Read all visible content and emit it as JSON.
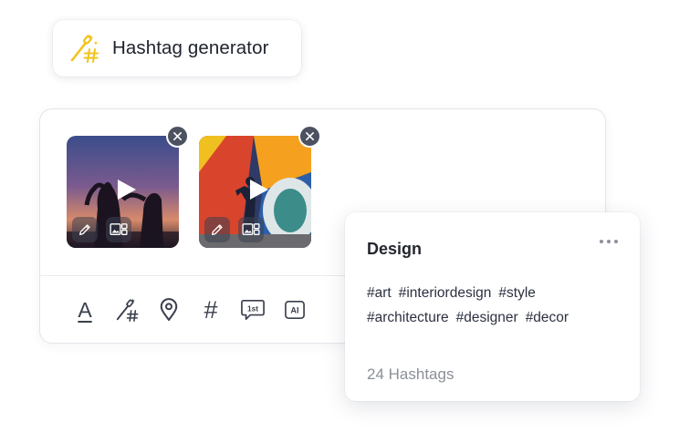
{
  "generator": {
    "title": "Hashtag generator",
    "icon": "magic-wand-hashtag-icon",
    "accent": "#f2c31a"
  },
  "composer": {
    "media": [
      {
        "type": "video",
        "icon": "play-icon"
      },
      {
        "type": "video",
        "icon": "play-icon"
      }
    ],
    "toolbar": [
      {
        "icon": "text-format-icon",
        "glyph": "A"
      },
      {
        "icon": "hashtag-generator-icon"
      },
      {
        "icon": "location-pin-icon"
      },
      {
        "icon": "hashtag-icon",
        "glyph": "#"
      },
      {
        "icon": "first-comment-icon"
      },
      {
        "icon": "ai-assistant-icon"
      }
    ]
  },
  "design_card": {
    "title": "Design",
    "tags": [
      "#art",
      "#interiordesign",
      "#style",
      "#architecture",
      "#designer",
      "#decor"
    ],
    "count_label": "24 Hashtags"
  }
}
